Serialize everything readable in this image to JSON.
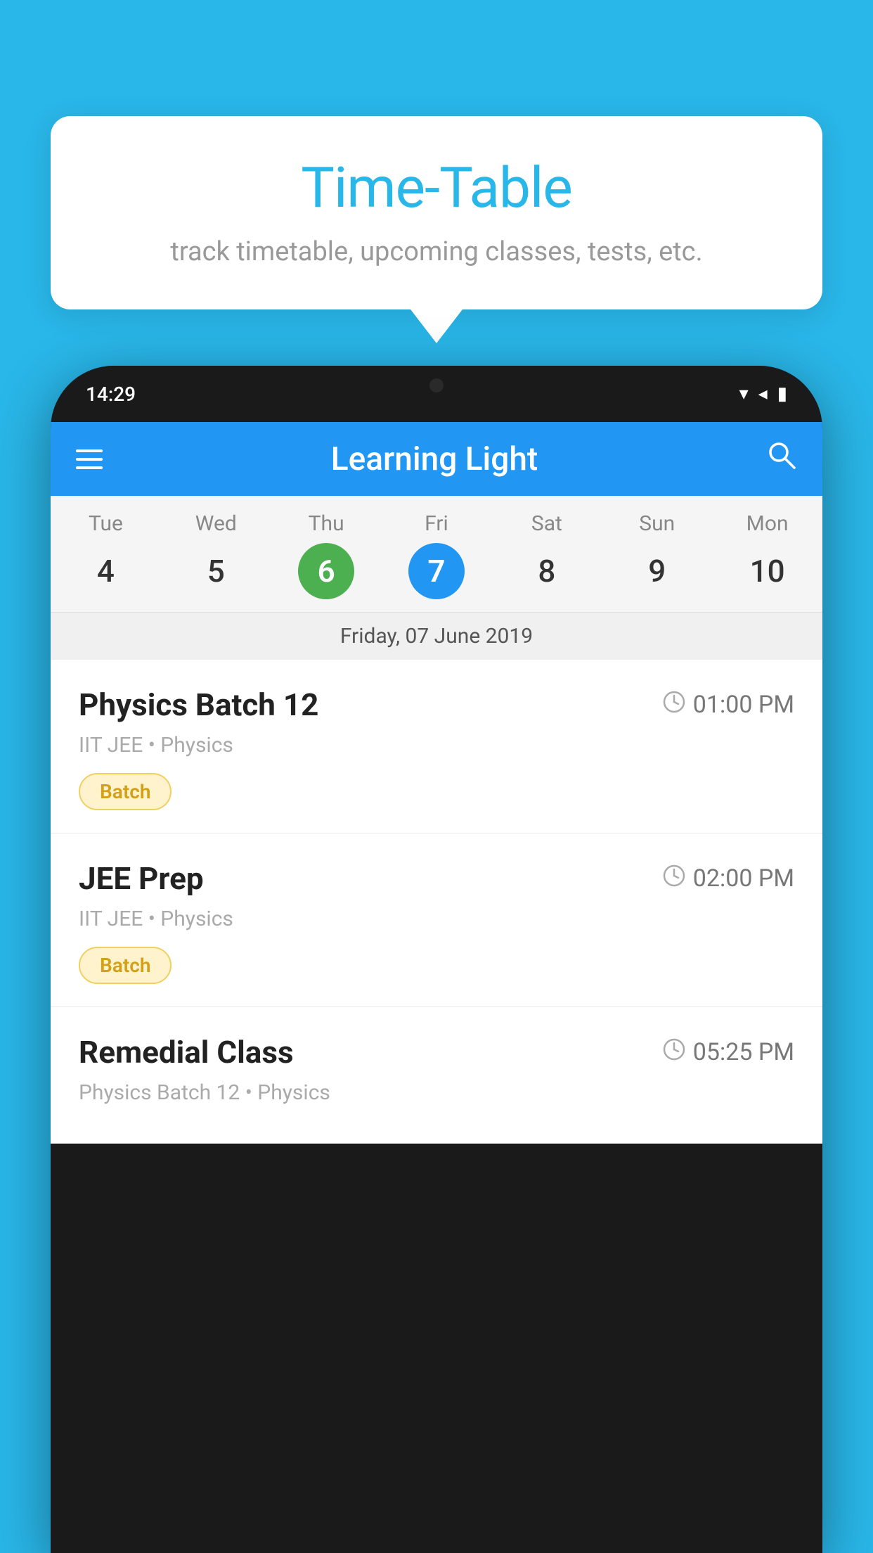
{
  "background_color": "#29B6E8",
  "tooltip": {
    "title": "Time-Table",
    "subtitle": "track timetable, upcoming classes, tests, etc."
  },
  "phone": {
    "status_bar": {
      "time": "14:29",
      "wifi": "▼",
      "signal": "▲",
      "battery": "▮"
    },
    "toolbar": {
      "title": "Learning Light",
      "hamburger_label": "menu",
      "search_label": "search"
    },
    "calendar": {
      "weekdays": [
        "Tue",
        "Wed",
        "Thu",
        "Fri",
        "Sat",
        "Sun",
        "Mon"
      ],
      "dates": [
        4,
        5,
        6,
        7,
        8,
        9,
        10
      ],
      "today_index": 2,
      "selected_index": 3,
      "selected_date_label": "Friday, 07 June 2019"
    },
    "schedule": [
      {
        "title": "Physics Batch 12",
        "time": "01:00 PM",
        "meta": "IIT JEE • Physics",
        "badge": "Batch"
      },
      {
        "title": "JEE Prep",
        "time": "02:00 PM",
        "meta": "IIT JEE • Physics",
        "badge": "Batch"
      },
      {
        "title": "Remedial Class",
        "time": "05:25 PM",
        "meta": "Physics Batch 12 • Physics",
        "badge": ""
      }
    ]
  }
}
